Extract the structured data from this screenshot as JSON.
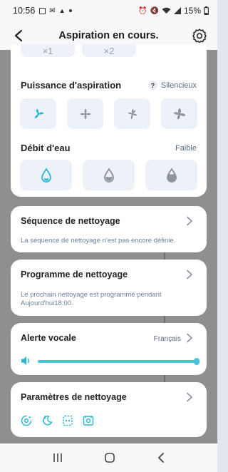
{
  "status_bar": {
    "time": "10:56",
    "battery": "15%"
  },
  "header": {
    "title": "Aspiration en cours."
  },
  "mode_peek": {
    "labels": [
      "×1",
      "×2"
    ]
  },
  "suction": {
    "title": "Puissance d'aspiration",
    "help": "?",
    "value": "Silencieux",
    "options": [
      "quiet-fan-icon",
      "standard-fan-icon",
      "strong-fan-icon",
      "max-fan-icon"
    ],
    "selected_index": 0
  },
  "water": {
    "title": "Débit d'eau",
    "value": "Faible",
    "options": [
      "water-low-icon",
      "water-medium-icon",
      "water-high-icon"
    ],
    "selected_index": 0
  },
  "sequence": {
    "title": "Séquence de nettoyage",
    "subtitle": "La séquence de nettoyage n'est pas encore définie."
  },
  "schedule": {
    "title": "Programme de nettoyage",
    "subtitle_line1": "Le prochain nettoyage est programmé pendant",
    "subtitle_line2": "Aujourd'hui18:00."
  },
  "voice": {
    "title": "Alerte vocale",
    "language": "Français",
    "volume": 1.0
  },
  "params": {
    "title": "Paramètres de nettoyage",
    "icons": [
      "carpet-boost-icon",
      "do-not-disturb-icon",
      "edge-cleaning-icon",
      "map-save-icon"
    ]
  },
  "colors": {
    "accent": "#47c4dc",
    "inactive_icon": "#8e949c",
    "button_bg": "#edf1f8"
  }
}
